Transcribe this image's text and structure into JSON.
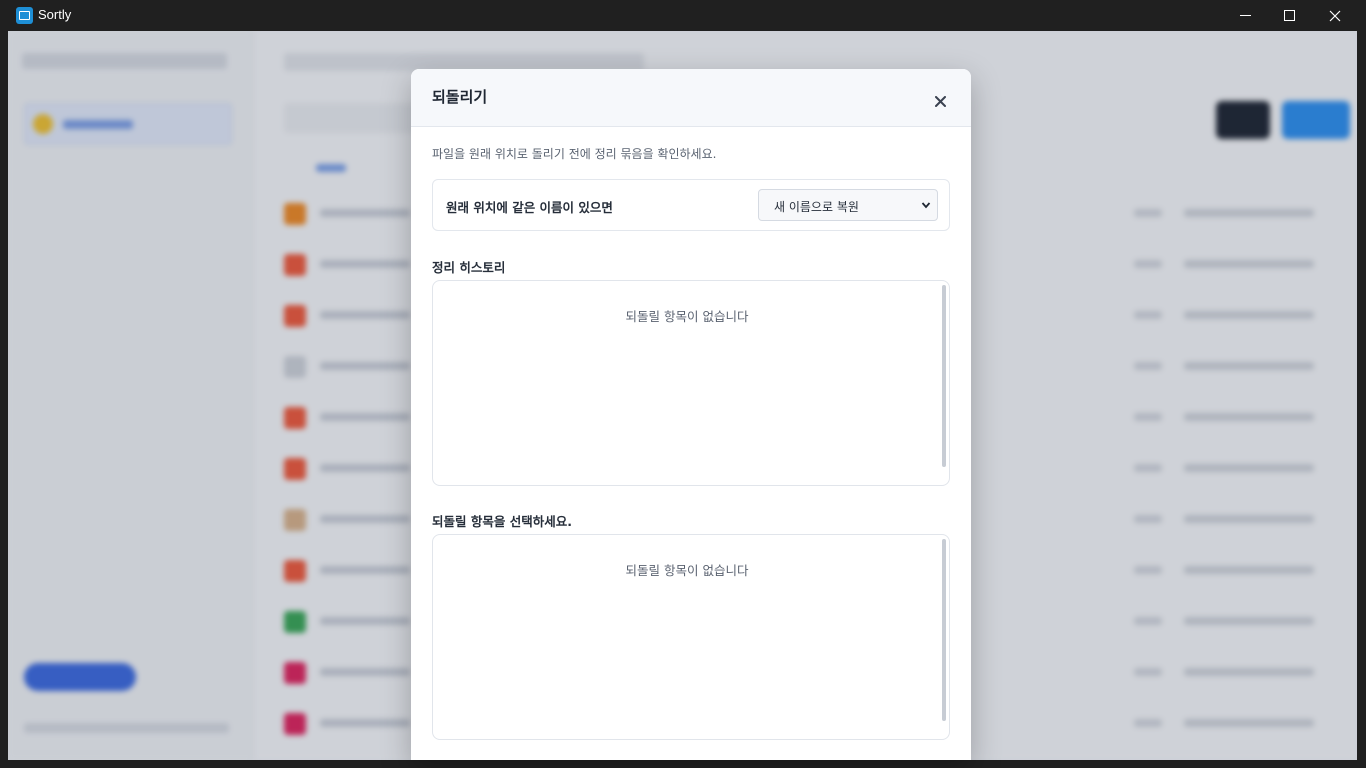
{
  "window": {
    "title": "Sortly"
  },
  "dialog": {
    "title": "되돌리기",
    "description": "파일을 원래 위치로 돌리기 전에 정리 묶음을 확인하세요.",
    "conflict_option": {
      "label": "원래 위치에 같은 이름이 있으면",
      "selected": "새 이름으로 복원"
    },
    "history_section": {
      "title": "정리 히스토리",
      "empty_text": "되돌릴 항목이 없습니다"
    },
    "items_section": {
      "title": "되돌릴 항목을 선택하세요.",
      "empty_text": "되돌릴 항목이 없습니다"
    }
  },
  "background_rows": [
    {
      "icon_color": "#f08a24"
    },
    {
      "icon_color": "#ef5a3c"
    },
    {
      "icon_color": "#ef5a3c"
    },
    {
      "icon_color": "#cfd3da"
    },
    {
      "icon_color": "#ef5a3c"
    },
    {
      "icon_color": "#ef5a3c"
    },
    {
      "icon_color": "#d9b38c"
    },
    {
      "icon_color": "#ef5a3c"
    },
    {
      "icon_color": "#3aa757"
    },
    {
      "icon_color": "#e0245e"
    },
    {
      "icon_color": "#e0245e"
    }
  ]
}
